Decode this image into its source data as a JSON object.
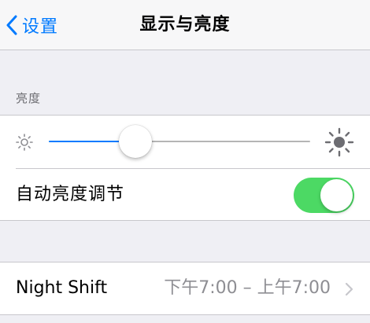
{
  "navbar": {
    "back_label": "设置",
    "title": "显示与亮度"
  },
  "brightness": {
    "section_header": "亮度",
    "slider_level": 0.33,
    "auto_label": "自动亮度调节",
    "auto_enabled": true
  },
  "night_shift": {
    "label": "Night Shift",
    "schedule": "下午7:00 – 上午7:00"
  },
  "icons": {
    "back": "chevron-left-icon",
    "min_brightness": "sun-small-icon",
    "max_brightness": "sun-large-icon",
    "disclosure": "chevron-right-icon"
  },
  "colors": {
    "accent": "#007aff",
    "switch_on": "#4cd964",
    "background": "#efeff4"
  }
}
